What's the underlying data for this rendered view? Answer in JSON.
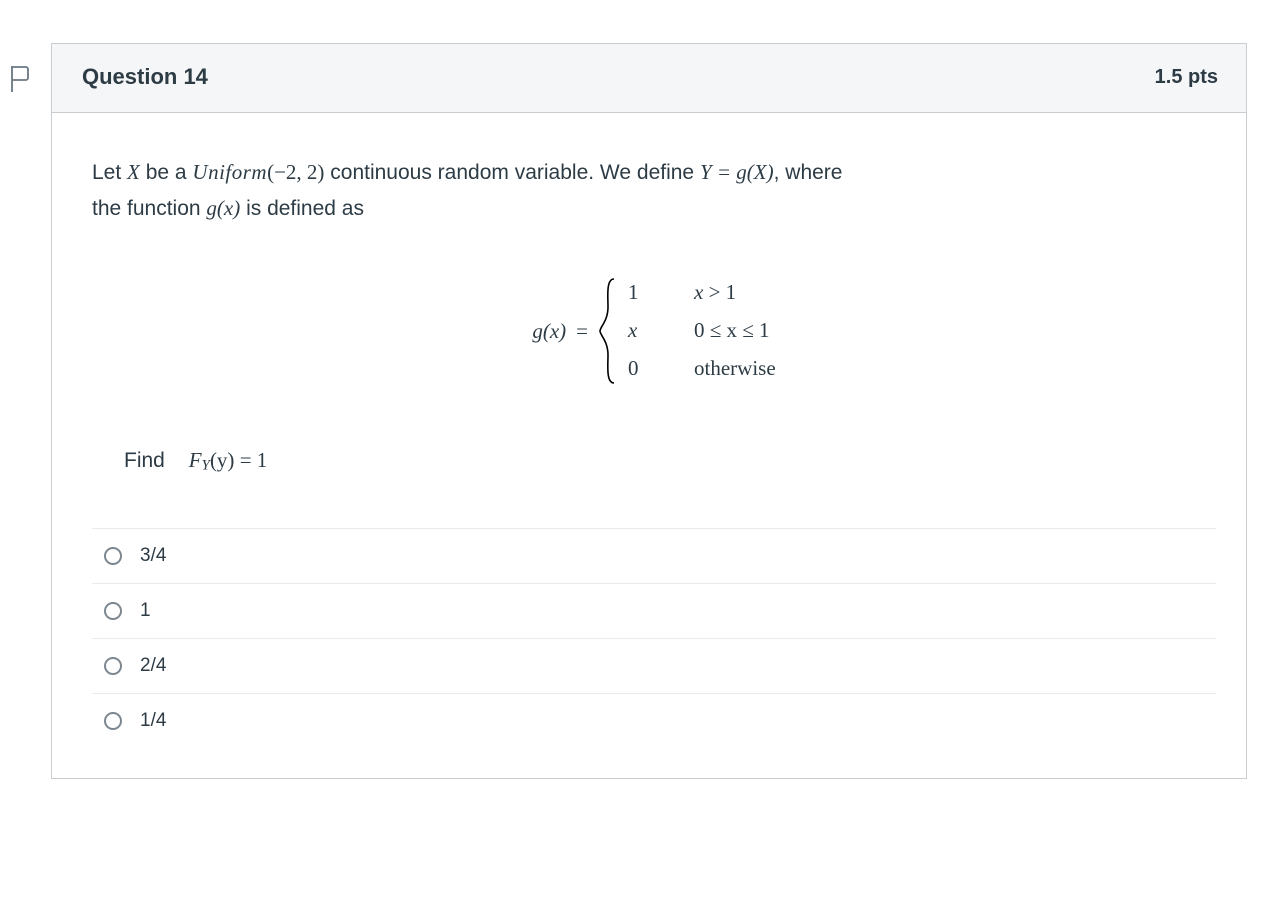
{
  "header": {
    "title": "Question 14",
    "points": "1.5 pts"
  },
  "question": {
    "line1_pre": "Let ",
    "var_X": "X",
    "line1_mid1": " be a ",
    "dist_name": "Uniform",
    "dist_args": "(−2, 2)",
    "line1_mid2": " continuous random variable. We define ",
    "eq_Y": "Y = g(X)",
    "line1_post": ", where",
    "line2_pre": "the function ",
    "gx": "g(x)",
    "line2_post": " is defined as",
    "piecewise": {
      "lhs": "g(x)",
      "eq": "=",
      "rows": [
        {
          "val": "1",
          "cond_pre": "x",
          "cond_op": " > ",
          "cond_post": "1"
        },
        {
          "val": "x",
          "cond_full": "0 ≤ x ≤ 1"
        },
        {
          "val": "0",
          "cond_text": "otherwise"
        }
      ]
    },
    "find": {
      "label": "Find",
      "F": "F",
      "sub": "Y",
      "arg": "(y)",
      "eq": " = 1"
    }
  },
  "answers": [
    {
      "label": "3/4"
    },
    {
      "label": "1"
    },
    {
      "label": "2/4"
    },
    {
      "label": "1/4"
    }
  ]
}
